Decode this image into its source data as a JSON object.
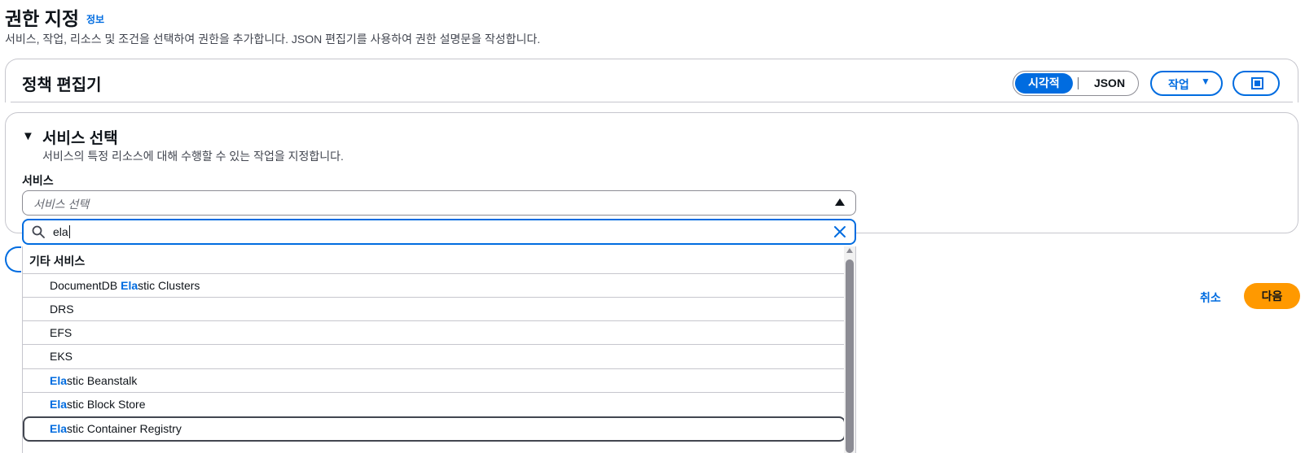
{
  "header": {
    "title": "권한 지정",
    "info_link": "정보",
    "description": "서비스, 작업, 리소스 및 조건을 선택하여 권한을 추가합니다. JSON 편집기를 사용하여 권한 설명문을 작성합니다."
  },
  "editor": {
    "title": "정책 편집기",
    "mode_toggle": {
      "visual": "시각적",
      "json": "JSON",
      "selected": "시각적"
    },
    "actions_label": "작업",
    "fullscreen_icon": "fullscreen-icon"
  },
  "service_section": {
    "title": "서비스 선택",
    "description": "서비스의 특정 리소스에 대해 수행할 수 있는 작업을 지정합니다.",
    "field_label": "서비스",
    "select_placeholder": "서비스 선택"
  },
  "search": {
    "value": "ela",
    "search_icon": "search-icon",
    "clear_icon": "close-icon"
  },
  "dropdown": {
    "group_label": "기타 서비스",
    "options": [
      {
        "pre": "DocumentDB ",
        "match": "Ela",
        "post": "stic Clusters"
      },
      {
        "pre": "DRS",
        "match": "",
        "post": ""
      },
      {
        "pre": "EFS",
        "match": "",
        "post": ""
      },
      {
        "pre": "EKS",
        "match": "",
        "post": ""
      },
      {
        "pre": "",
        "match": "Ela",
        "post": "stic Beanstalk"
      },
      {
        "pre": "",
        "match": "Ela",
        "post": "stic Block Store"
      },
      {
        "pre": "",
        "match": "Ela",
        "post": "stic Container Registry"
      }
    ],
    "focused_option": "Elastic Container Registry"
  },
  "footer": {
    "cancel_label": "취소",
    "next_label": "다음"
  },
  "colors": {
    "accent": "#006ce0",
    "primary_button": "#ff9900",
    "border": "#c6c6cd"
  }
}
